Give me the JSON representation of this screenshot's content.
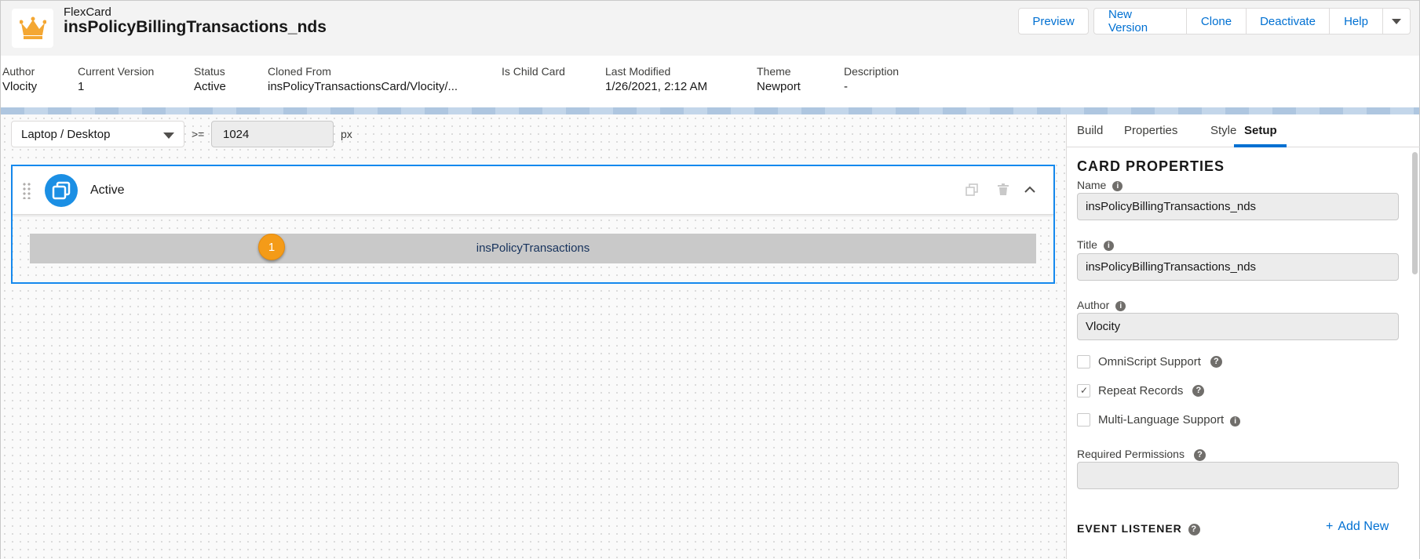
{
  "header": {
    "object_type": "FlexCard",
    "title": "insPolicyBillingTransactions_nds",
    "buttons": [
      "Preview",
      "New Version",
      "Clone",
      "Deactivate",
      "Help"
    ]
  },
  "meta": {
    "author_label": "Author",
    "author": "Vlocity",
    "version_label": "Current Version",
    "version": "1",
    "status_label": "Status",
    "status": "Active",
    "cloned_label": "Cloned From",
    "cloned": "insPolicyTransactionsCard/Vlocity/...",
    "child_label": "Is Child Card",
    "modified_label": "Last Modified",
    "modified": "1/26/2021, 2:12 AM",
    "theme_label": "Theme",
    "theme": "Newport",
    "desc_label": "Description",
    "desc": "-"
  },
  "canvas": {
    "device": "Laptop / Desktop",
    "gte": ">=",
    "width_value": "1024",
    "unit": "px",
    "state_name": "Active",
    "child_card": "insPolicyTransactions",
    "badge": "1"
  },
  "panel": {
    "tabs": [
      "Build",
      "Properties",
      "Style",
      "Setup"
    ],
    "active_tab": "Setup",
    "section_title": "CARD PROPERTIES",
    "name_label": "Name",
    "name_value": "insPolicyBillingTransactions_nds",
    "title_label": "Title",
    "title_value": "insPolicyBillingTransactions_nds",
    "author_label": "Author",
    "author_value": "Vlocity",
    "omniscript_label": "OmniScript Support",
    "repeat_label": "Repeat Records",
    "multilang_label": "Multi-Language Support",
    "permissions_label": "Required Permissions",
    "permissions_value": "",
    "event_title": "EVENT LISTENER",
    "add_new": "Add New"
  },
  "colors": {
    "brand": "#0070d2",
    "state_icon": "#1b8fe4",
    "badge": "#f49b18",
    "logo": "#f4a733"
  }
}
